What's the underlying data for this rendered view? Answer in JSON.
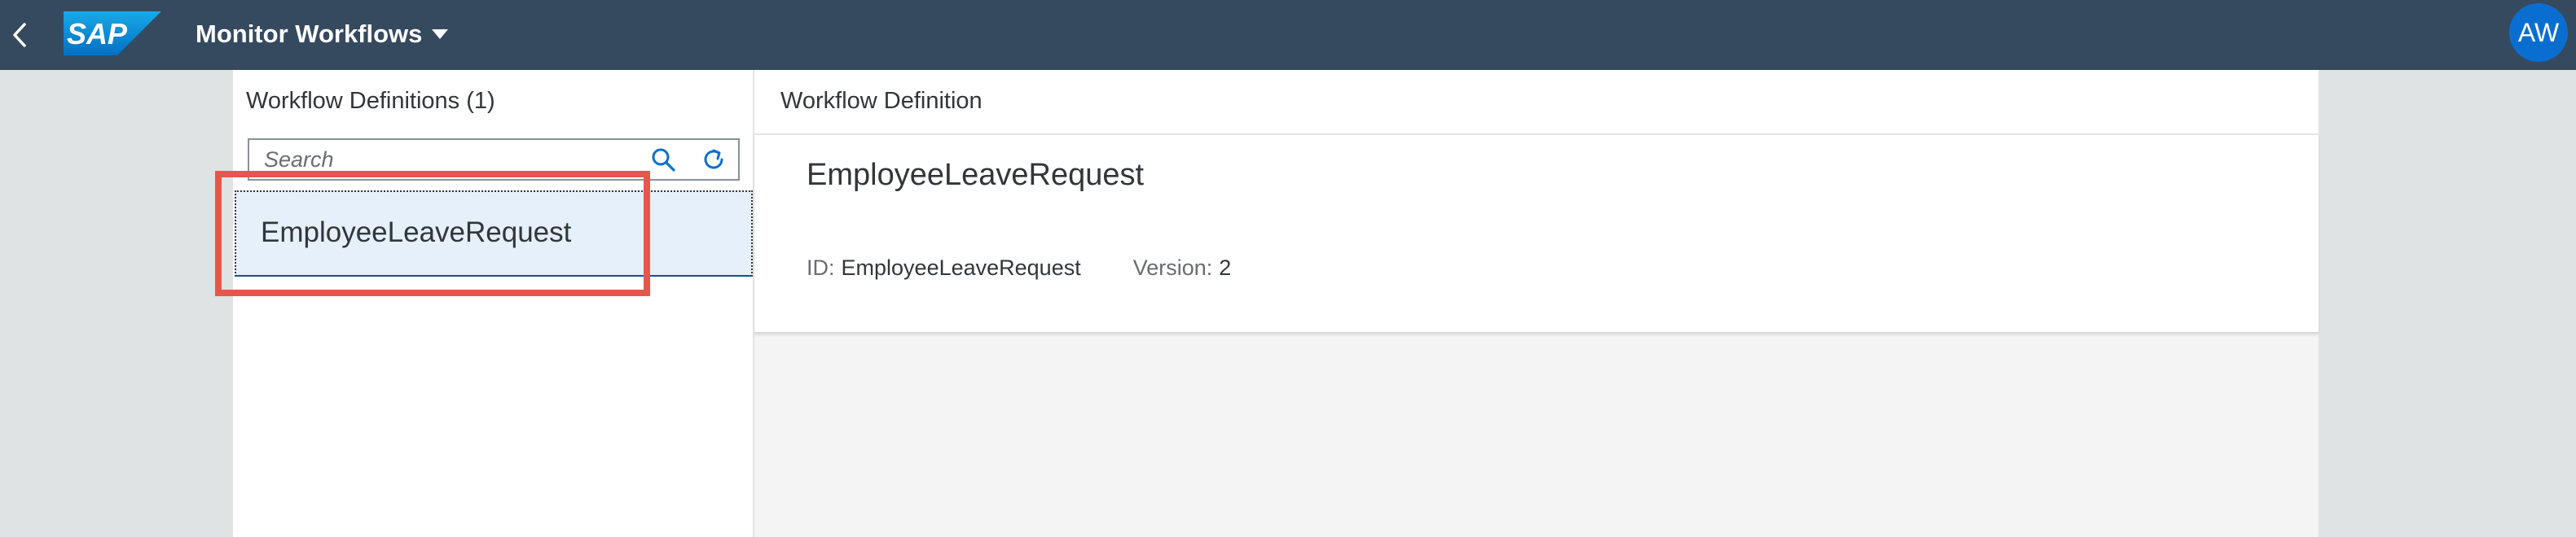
{
  "shell": {
    "app_title": "Monitor Workflows",
    "logo_text": "SAP",
    "avatar_initials": "AW",
    "colors": {
      "shellbar": "#354a5f",
      "avatar": "#0a6ed1",
      "highlight": "#e4584b",
      "selected_row": "#e5f0fa"
    },
    "icons": {
      "back": "chevron-left-icon",
      "title_menu": "caret-down-icon"
    }
  },
  "master": {
    "title": "Workflow Definitions (1)",
    "search": {
      "placeholder": "Search",
      "value": "",
      "search_icon": "search-icon",
      "refresh_icon": "refresh-icon"
    },
    "items": [
      {
        "label": "EmployeeLeaveRequest",
        "selected": true
      }
    ]
  },
  "detail": {
    "header_title": "Workflow Definition",
    "object_title": "EmployeeLeaveRequest",
    "attributes": [
      {
        "label": "ID:",
        "value": "EmployeeLeaveRequest"
      },
      {
        "label": "Version:",
        "value": "2"
      }
    ]
  }
}
